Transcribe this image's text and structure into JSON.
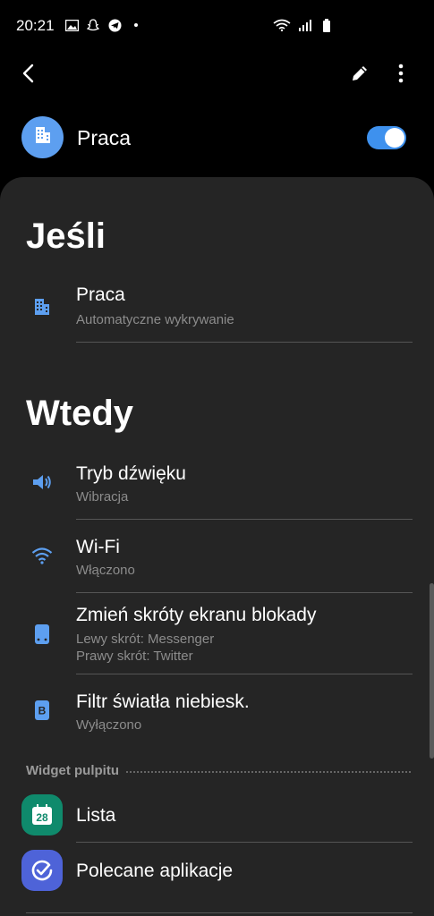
{
  "status_bar": {
    "time": "20:21",
    "left_icons": [
      "image-icon",
      "snapchat-icon",
      "telegram-icon",
      "dot-icon"
    ],
    "right_icons": [
      "wifi-icon",
      "signal-icon",
      "battery-icon"
    ]
  },
  "toolbar": {
    "back_icon": "arrow-left-icon",
    "edit_icon": "pencil-icon",
    "more_icon": "more-vertical-icon"
  },
  "mode": {
    "title": "Praca",
    "icon": "building-icon",
    "enabled": true,
    "accent": "#3e91ee"
  },
  "if_section": {
    "title": "Jeśli",
    "items": [
      {
        "title": "Praca",
        "subtitle": "Automatyczne wykrywanie",
        "icon": "building-icon"
      }
    ]
  },
  "then_section": {
    "title": "Wtedy",
    "items": [
      {
        "title": "Tryb dźwięku",
        "subtitle": "Wibracja",
        "icon": "speaker-icon"
      },
      {
        "title": "Wi-Fi",
        "subtitle": "Włączono",
        "icon": "wifi-icon"
      },
      {
        "title": "Zmień skróty ekranu blokady",
        "subtitle": "Lewy skrót: Messenger",
        "subtitle2": "Prawy skrót: Twitter",
        "icon": "phone-icon"
      },
      {
        "title": "Filtr światła niebiesk.",
        "subtitle": "Wyłączono",
        "icon": "blue-light-filter-icon"
      }
    ]
  },
  "widget_section": {
    "label": "Widget pulpitu",
    "items": [
      {
        "title": "Lista",
        "icon": "calendar-icon",
        "icon_text": "28",
        "color": "#0f8a6c"
      },
      {
        "title": "Polecane aplikacje",
        "icon": "check-circle-icon",
        "color": "#4e63d8"
      }
    ]
  }
}
